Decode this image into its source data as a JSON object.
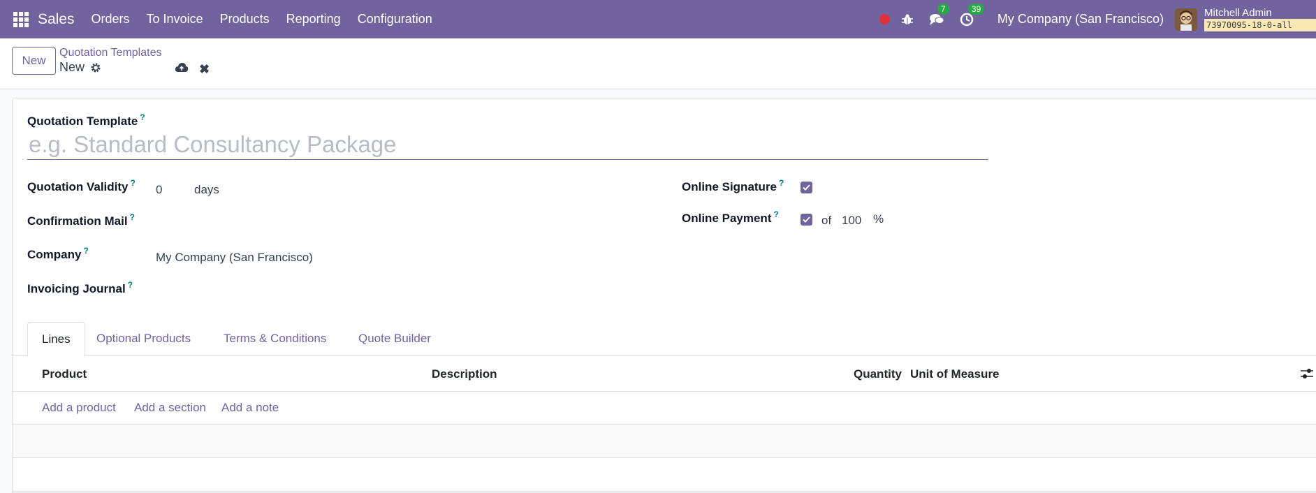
{
  "navbar": {
    "app_name": "Sales",
    "menu": [
      "Orders",
      "To Invoice",
      "Products",
      "Reporting",
      "Configuration"
    ],
    "messages_badge": "7",
    "activities_badge": "39",
    "company": "My Company (San Francisco)",
    "user_name": "Mitchell Admin",
    "db_name": "73970095-18-0-all",
    "colors": {
      "navbar_bg": "#71639e",
      "badge": "#28a745",
      "record_dot": "#e0303a"
    }
  },
  "control_panel": {
    "new_button": "New",
    "breadcrumb": "Quotation Templates",
    "record_name": "New"
  },
  "form": {
    "template_label": "Quotation Template",
    "template_placeholder": "e.g. Standard Consultancy Package",
    "help_mark": "?",
    "validity_label": "Quotation Validity",
    "validity_value": "0",
    "validity_unit": "days",
    "confirmation_mail_label": "Confirmation Mail",
    "company_label": "Company",
    "company_value": "My Company (San Francisco)",
    "journal_label": "Invoicing Journal",
    "online_signature_label": "Online Signature",
    "online_signature_checked": true,
    "online_payment_label": "Online Payment",
    "online_payment_checked": true,
    "payment_of": "of",
    "payment_percent": "100",
    "payment_percent_unit": "%"
  },
  "tabs": [
    "Lines",
    "Optional Products",
    "Terms & Conditions",
    "Quote Builder"
  ],
  "active_tab": "Lines",
  "lines_table": {
    "columns": [
      "Product",
      "Description",
      "Quantity",
      "Unit of Measure"
    ],
    "add_product": "Add a product",
    "add_section": "Add a section",
    "add_note": "Add a note"
  }
}
